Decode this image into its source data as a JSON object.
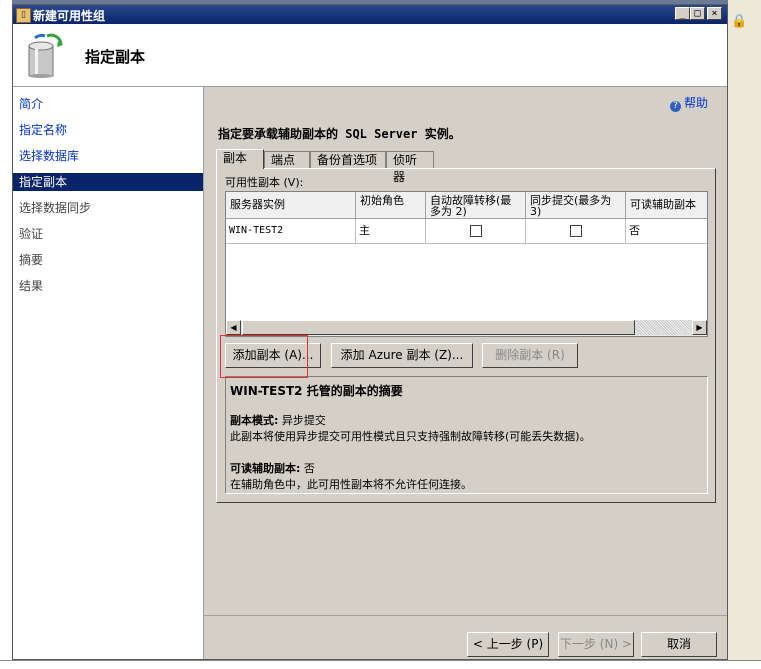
{
  "window": {
    "title": "新建可用性组",
    "min": "_",
    "max": "□",
    "close": "×"
  },
  "header": {
    "title": "指定副本"
  },
  "nav": {
    "items": [
      {
        "label": "简介",
        "state": "link"
      },
      {
        "label": "指定名称",
        "state": "link"
      },
      {
        "label": "选择数据库",
        "state": "link"
      },
      {
        "label": "指定副本",
        "state": "selected"
      },
      {
        "label": "选择数据同步",
        "state": "dim"
      },
      {
        "label": "验证",
        "state": "dim"
      },
      {
        "label": "摘要",
        "state": "dim"
      },
      {
        "label": "结果",
        "state": "dim"
      }
    ]
  },
  "help": {
    "label": "帮助"
  },
  "instruction": "指定要承载辅助副本的 SQL Server 实例。",
  "tabs": [
    "副本",
    "端点",
    "备份首选项",
    "侦听器"
  ],
  "grid": {
    "caption": "可用性副本 (V):",
    "columns": [
      "服务器实例",
      "初始角色",
      "自动故障转移(最多为 2)",
      "同步提交(最多为 3)",
      "可读辅助副本"
    ],
    "rows": [
      {
        "server": "WIN-TEST2",
        "role": "主",
        "auto_failover": false,
        "sync_commit": false,
        "readable": "否"
      }
    ]
  },
  "buttons": {
    "add_replica": "添加副本 (A)...",
    "add_azure": "添加 Azure 副本 (Z)...",
    "remove_replica": "删除副本 (R)"
  },
  "summary": {
    "title": "WIN-TEST2 托管的副本的摘要",
    "mode_label": "副本模式:",
    "mode_value": "异步提交",
    "mode_desc": "此副本将使用异步提交可用性模式且只支持强制故障转移(可能丢失数据)。",
    "readable_label": "可读辅助副本:",
    "readable_value": "否",
    "readable_desc": "在辅助角色中，此可用性副本将不允许任何连接。"
  },
  "footer": {
    "prev": "< 上一步 (P)",
    "next": "下一步 (N) >",
    "cancel": "取消"
  }
}
